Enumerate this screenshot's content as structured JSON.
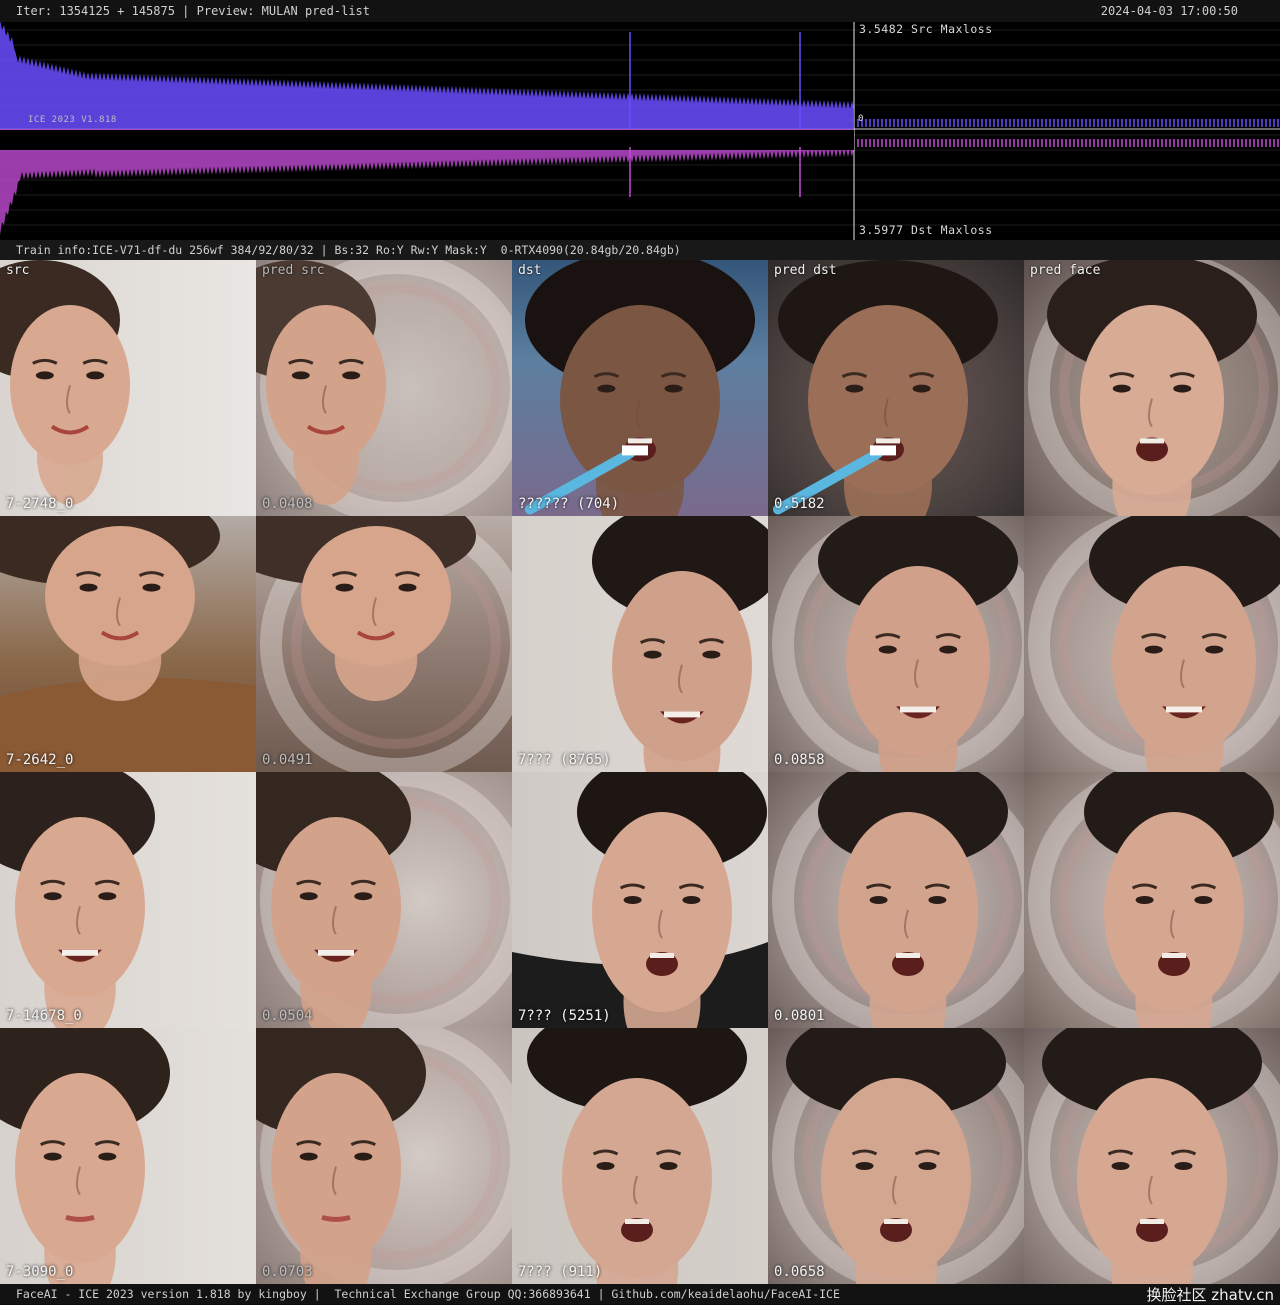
{
  "header": {
    "iter": "Iter: 1354125 + 145875 | Preview: MULAN pred-list",
    "timestamp": "2024-04-03 17:00:50"
  },
  "graph": {
    "src_label": "3.5482 Src Maxloss",
    "dst_label": "3.5977 Dst Maxloss",
    "version_label": "ICE 2023 V1.818",
    "zero_label": "0",
    "src_color": "#6a4cff",
    "dst_color": "#c24bd6"
  },
  "train_info": "Train info:ICE-V71-df-du 256wf 384/92/80/32 | Bs:32 Ro:Y Rw:Y Mask:Y  0-RTX4090(20.84gb/20.84gb)",
  "columns": [
    "src",
    "pred src",
    "dst",
    "pred dst",
    "pred face"
  ],
  "rows": [
    {
      "values": [
        "7-2748_0",
        "0.0408",
        "?????? (704)",
        "0.5182",
        ""
      ]
    },
    {
      "values": [
        "7-2642_0",
        "0.0491",
        "7??? (8765)",
        "0.0858",
        ""
      ]
    },
    {
      "values": [
        "7-14678_0",
        "0.0504",
        "7??? (5251)",
        "0.0801",
        ""
      ]
    },
    {
      "values": [
        "7-3090_0",
        "0.0703",
        "7??? (911)",
        "0.0658",
        ""
      ]
    }
  ],
  "footer": {
    "text": "FaceAI - ICE 2023 version 1.818 by kingboy |  Technical Exchange Group QQ:366893641 | Github.com/keaidelaohu/FaceAI-ICE",
    "watermark": "换脸社区 zhatv.cn"
  }
}
